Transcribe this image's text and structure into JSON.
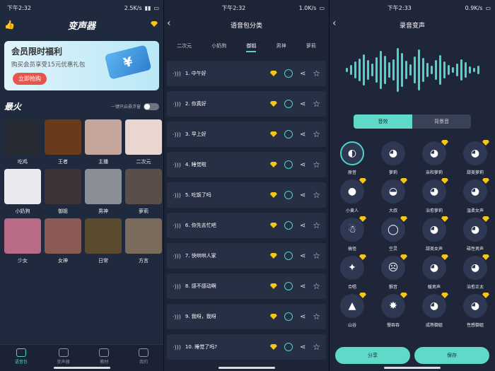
{
  "p1": {
    "status": {
      "time": "下午2:32",
      "speed": "2.5K/s"
    },
    "title": "变声器",
    "banner": {
      "title": "会员限时福利",
      "sub": "购买会员享受15元优惠礼包",
      "btn": "立即抢购",
      "ticket": "¥"
    },
    "hot": {
      "title": "最火",
      "toggle_label": "一键开启悬浮窗"
    },
    "items": [
      {
        "label": "吃鸡",
        "bg": "#262b33"
      },
      {
        "label": "王者",
        "bg": "#6a3a1c"
      },
      {
        "label": "主播",
        "bg": "#c4a79a"
      },
      {
        "label": "二次元",
        "bg": "#e9d6d0"
      },
      {
        "label": "小奶狗",
        "bg": "#e9e9ee"
      },
      {
        "label": "御姐",
        "bg": "#3c3438"
      },
      {
        "label": "男神",
        "bg": "#8a8f97"
      },
      {
        "label": "萝莉",
        "bg": "#5b4e48"
      },
      {
        "label": "少女",
        "bg": "#b96a84"
      },
      {
        "label": "女神",
        "bg": "#8c5a55"
      },
      {
        "label": "日常",
        "bg": "#5a4a2e"
      },
      {
        "label": "方言",
        "bg": "#7a6b5c"
      }
    ],
    "tabs": [
      {
        "label": "语音包",
        "active": true
      },
      {
        "label": "变声器"
      },
      {
        "label": "教材"
      },
      {
        "label": "我的"
      }
    ]
  },
  "p2": {
    "status": {
      "time": "下午2:32",
      "speed": "1.0K/s"
    },
    "title": "语音包分类",
    "cats": [
      "二次元",
      "小奶狗",
      "御姐",
      "男神",
      "萝莉"
    ],
    "active_cat": "御姐",
    "rows": [
      "1. 中午好",
      "2. 你真好",
      "3. 早上好",
      "4. 睡觉啦",
      "5. 吃饭了吗",
      "6. 你先去忙吧",
      "7. 快哄哄人家",
      "8. 感不感动啊",
      "9. 我呀，我呀",
      "10. 睡觉了吗?"
    ]
  },
  "p3": {
    "status": {
      "time": "下午2:33",
      "speed": "0.9K/s"
    },
    "title": "录音变声",
    "seg": {
      "left": "音效",
      "right": "背景音"
    },
    "effects": [
      "原音",
      "萝莉",
      "亲和萝莉",
      "甜美萝莉",
      "小黄人",
      "大叔",
      "治愈萝莉",
      "温柔女声",
      "搞怪",
      "空灵",
      "甜美女声",
      "磁性男声",
      "合唱",
      "颤音",
      "暖男声",
      "治愈正太",
      "山谷",
      "慢吞吞",
      "成熟御姐",
      "性感御姐"
    ],
    "effect_icons": [
      "◐",
      "◕",
      "◕",
      "◕",
      "●",
      "◒",
      "◕",
      "◕",
      "☃",
      "◯",
      "◕",
      "◕",
      "✦",
      "☹",
      "◕",
      "◕",
      "▲",
      "✸",
      "◕",
      "◕"
    ],
    "share": "分享",
    "save": "保存"
  },
  "colors": {
    "accent": "#4fd3c4",
    "gold": "#f5c518",
    "banner_btn": "#e7544c"
  }
}
